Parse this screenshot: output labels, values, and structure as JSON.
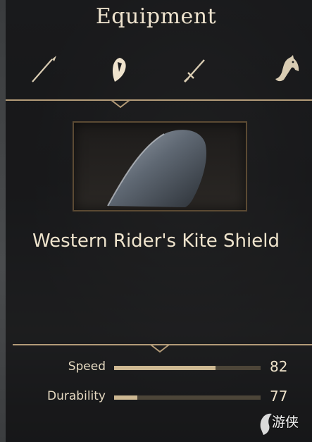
{
  "header": {
    "title": "Equipment"
  },
  "tabs": [
    {
      "icon": "spear-icon",
      "active": false
    },
    {
      "icon": "shield-icon",
      "active": true
    },
    {
      "icon": "sword-icon",
      "active": false
    },
    {
      "icon": "horse-icon",
      "active": false
    }
  ],
  "item": {
    "image": "kite-shield-image",
    "name": "Western Rider's Kite Shield"
  },
  "stats": [
    {
      "label": "Speed",
      "value": "82",
      "fill": 0.69
    },
    {
      "label": "Durability",
      "value": "77",
      "fill": 0.16
    }
  ],
  "watermark": {
    "text": "游侠",
    "logo": "watermark-logo"
  },
  "colors": {
    "accent": "#cdb892",
    "frame": "#5b4a33",
    "text": "#e9dcc4",
    "bar_track": "#4c4538"
  }
}
